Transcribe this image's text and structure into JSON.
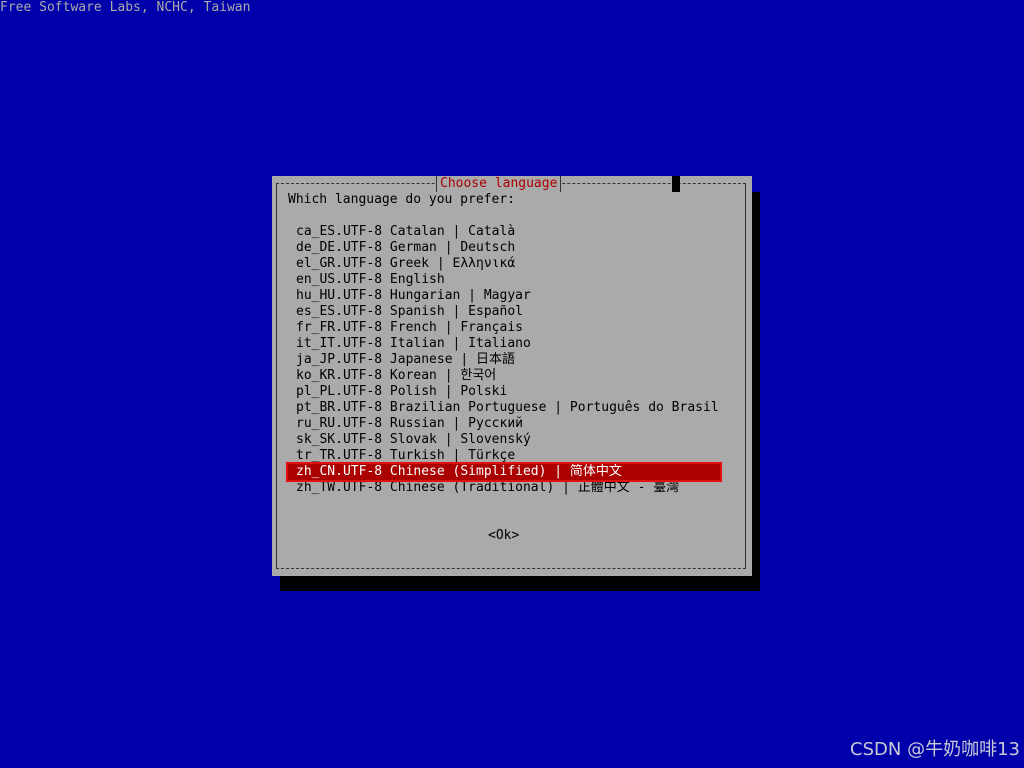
{
  "backtitle": "Free Software Labs, NCHC, Taiwan",
  "dialog": {
    "title": "Choose language",
    "prompt": "Which language do you prefer:",
    "ok_label": "<Ok>",
    "selected_index": 15,
    "items": [
      {
        "label": "ca_ES.UTF-8 Catalan | Català"
      },
      {
        "label": "de_DE.UTF-8 German | Deutsch"
      },
      {
        "label": "el_GR.UTF-8 Greek | Ελληνικά"
      },
      {
        "label": "en_US.UTF-8 English"
      },
      {
        "label": "hu_HU.UTF-8 Hungarian | Magyar"
      },
      {
        "label": "es_ES.UTF-8 Spanish | Español"
      },
      {
        "label": "fr_FR.UTF-8 French | Français"
      },
      {
        "label": "it_IT.UTF-8 Italian | Italiano"
      },
      {
        "label": "ja_JP.UTF-8 Japanese | 日本語"
      },
      {
        "label": "ko_KR.UTF-8 Korean | 한국어"
      },
      {
        "label": "pl_PL.UTF-8 Polish | Polski"
      },
      {
        "label": "pt_BR.UTF-8 Brazilian Portuguese | Português do Brasil"
      },
      {
        "label": "ru_RU.UTF-8 Russian | Русский"
      },
      {
        "label": "sk_SK.UTF-8 Slovak | Slovenský"
      },
      {
        "label": "tr_TR.UTF-8 Turkish | Türkçe"
      },
      {
        "label": "zh_CN.UTF-8 Chinese (Simplified) | 简体中文"
      },
      {
        "label": "zh_TW.UTF-8 Chinese (Traditional) | 正體中文 - 臺灣"
      }
    ]
  },
  "watermark": "CSDN @牛奶咖啡13",
  "colors": {
    "background": "#0000aa",
    "dialog": "#aaaaaa",
    "highlight": "#aa0000",
    "title_text": "#aa0000"
  }
}
